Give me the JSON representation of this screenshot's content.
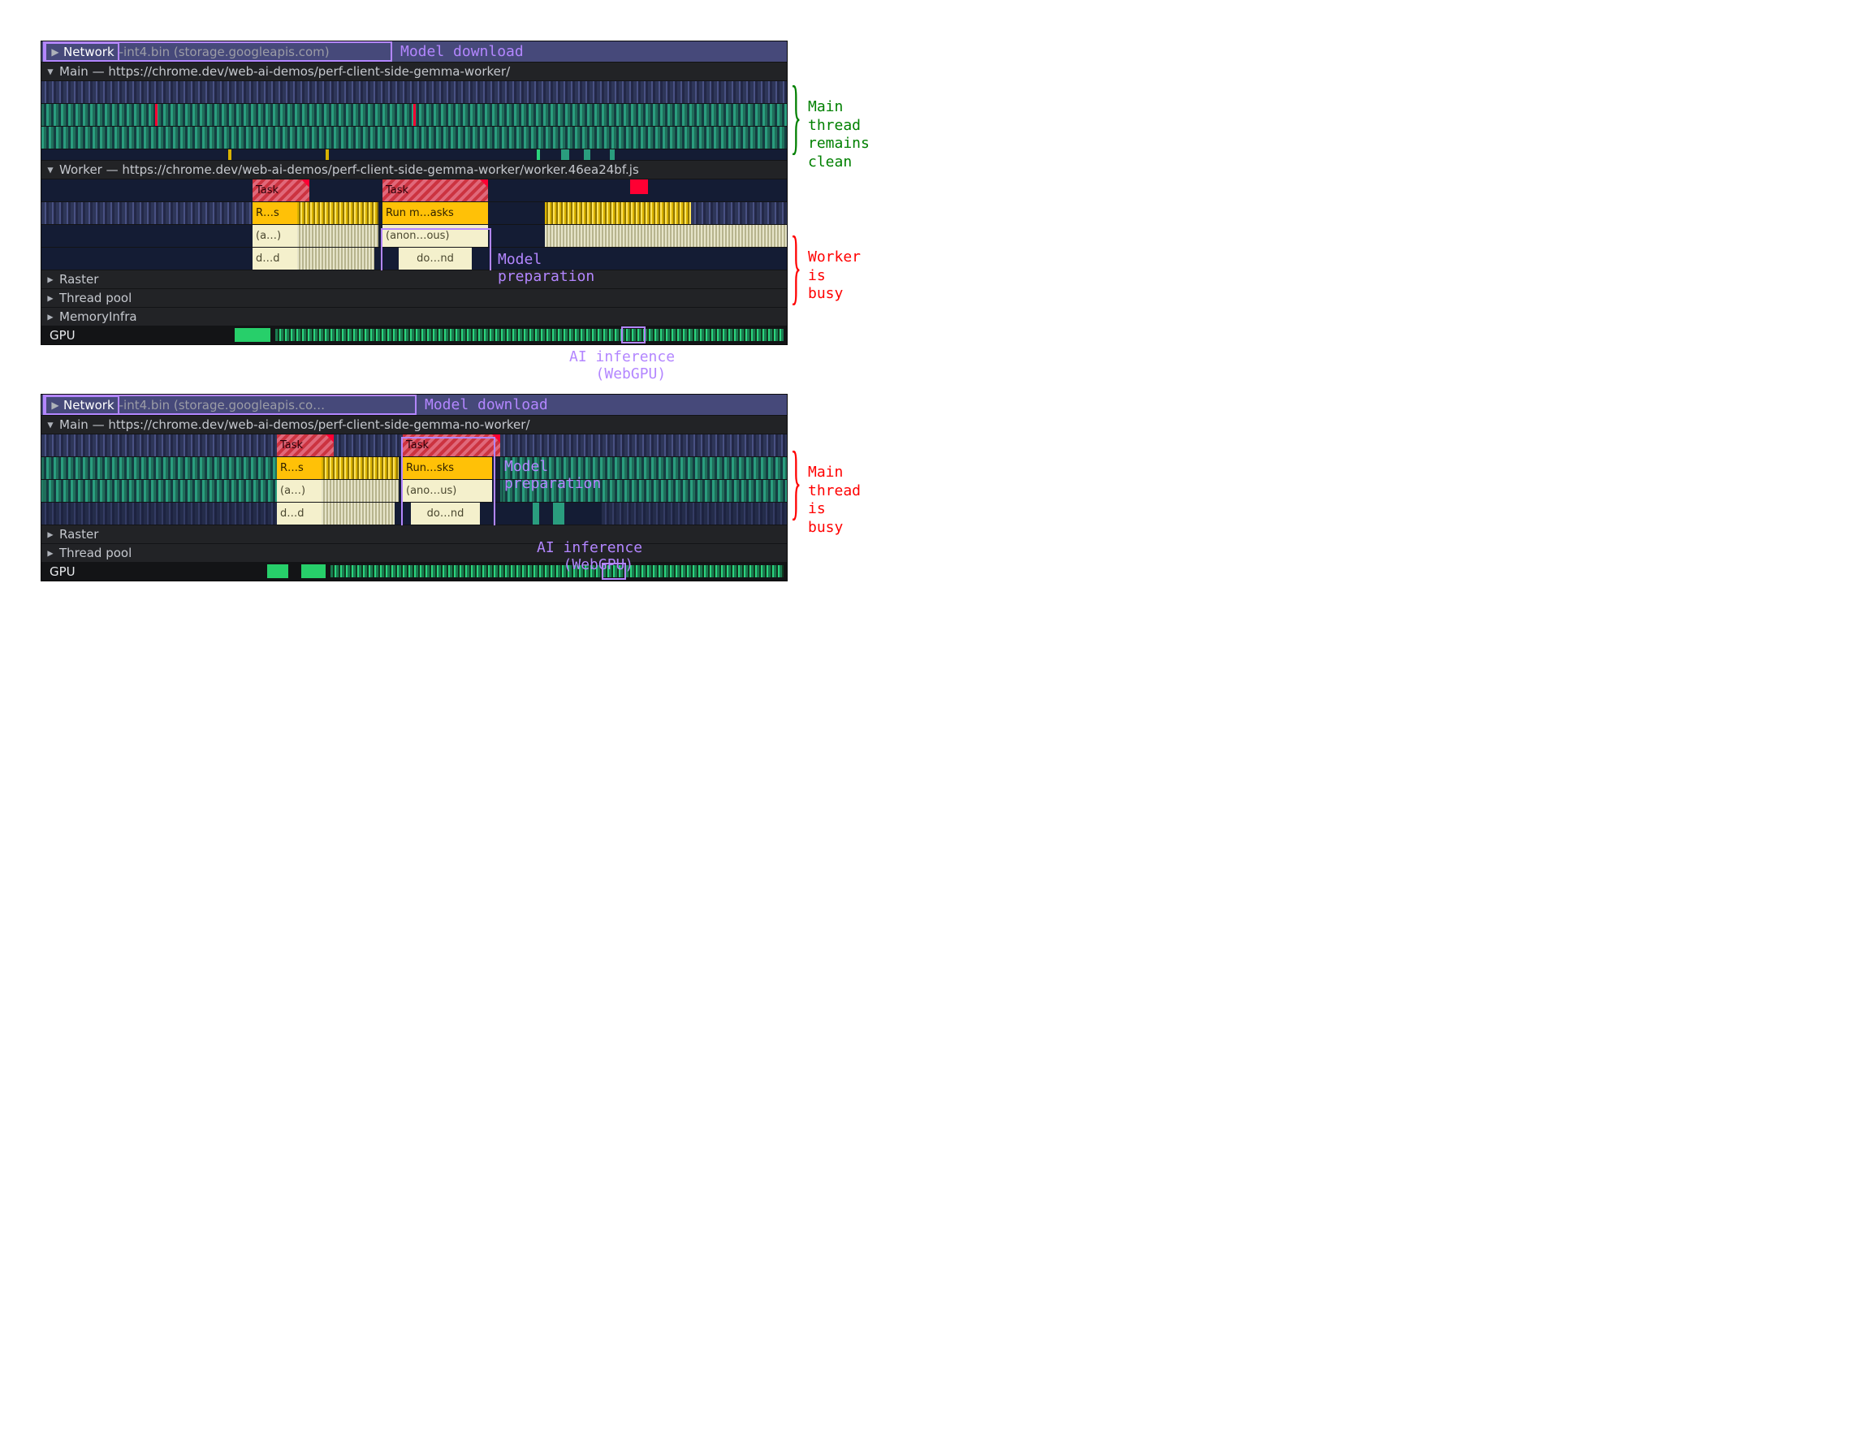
{
  "panelA": {
    "network": {
      "label": "Network",
      "file": "-int4.bin (storage.googleapis.com)"
    },
    "main": {
      "header": "Main — https://chrome.dev/web-ai-demos/perf-client-side-gemma-worker/"
    },
    "worker": {
      "header": "Worker — https://chrome.dev/web-ai-demos/perf-client-side-gemma-worker/worker.46ea24bf.js",
      "tasks": {
        "t1": "Task",
        "t2": "Task",
        "r1": "R…s",
        "r2": "Run m…asks",
        "a1": "(a…)",
        "a2": "(anon…ous)",
        "d1": "d…d",
        "d2": "do…nd"
      }
    },
    "collapsed": {
      "raster": "Raster",
      "threadpool": "Thread pool",
      "memoryinfra": "MemoryInfra"
    },
    "gpu": "GPU",
    "ann": {
      "modelDownload": "Model download",
      "mainClean1": "Main thread",
      "mainClean2": "remains clean",
      "workerBusy1": "Worker",
      "workerBusy2": "is busy",
      "modelPrep1": "Model",
      "modelPrep2": "preparation",
      "aiInf1": "AI inference",
      "aiInf2": "(WebGPU)"
    }
  },
  "panelB": {
    "network": {
      "label": "Network",
      "file": "-int4.bin (storage.googleapis.co…"
    },
    "main": {
      "header": "Main — https://chrome.dev/web-ai-demos/perf-client-side-gemma-no-worker/",
      "tasks": {
        "t1": "Task",
        "t2": "Task",
        "r1": "R…s",
        "r2": "Run…sks",
        "a1": "(a…)",
        "a2": "(ano…us)",
        "d1": "d…d",
        "d2": "do…nd"
      }
    },
    "collapsed": {
      "raster": "Raster",
      "threadpool": "Thread pool"
    },
    "gpu": "GPU",
    "ann": {
      "modelDownload": "Model download",
      "mainBusy1": "Main thread",
      "mainBusy2": "is busy",
      "modelPrep1": "Model",
      "modelPrep2": "preparation",
      "aiInf1": "AI inference",
      "aiInf2": "(WebGPU)"
    }
  }
}
